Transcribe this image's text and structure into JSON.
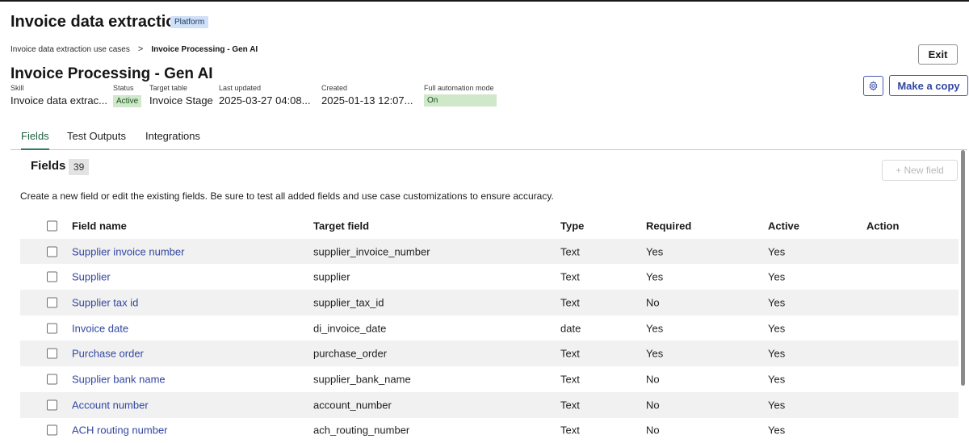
{
  "app": {
    "title": "Invoice data extraction",
    "badge": "Platform"
  },
  "breadcrumb": {
    "parent": "Invoice data extraction use cases",
    "separator": ">",
    "current": "Invoice Processing - Gen AI"
  },
  "page": {
    "title": "Invoice Processing - Gen AI",
    "exit_label": "Exit",
    "copy_label": "Make a copy",
    "settings_icon": "gear-icon"
  },
  "meta": {
    "skill_label": "Skill",
    "skill_value": "Invoice data extrac...",
    "status_label": "Status",
    "status_value": "Active",
    "target_label": "Target table",
    "target_value": "Invoice Stage",
    "updated_label": "Last updated",
    "updated_value": "2025-03-27 04:08...",
    "created_label": "Created",
    "created_value": "2025-01-13 12:07...",
    "automation_label": "Full automation mode",
    "automation_value": "On"
  },
  "tabs": [
    {
      "label": "Fields",
      "active": true
    },
    {
      "label": "Test Outputs",
      "active": false
    },
    {
      "label": "Integrations",
      "active": false
    }
  ],
  "fields": {
    "heading": "Fields",
    "count": "39",
    "new_button": "+ New field",
    "helper": "Create a new field or edit the existing fields. Be sure to test all added fields and use case customizations to ensure accuracy.",
    "columns": [
      "Field name",
      "Target field",
      "Type",
      "Required",
      "Active",
      "Action"
    ],
    "rows": [
      [
        "Supplier invoice number",
        "supplier_invoice_number",
        "Text",
        "Yes",
        "Yes"
      ],
      [
        "Supplier",
        "supplier",
        "Text",
        "Yes",
        "Yes"
      ],
      [
        "Supplier tax id",
        "supplier_tax_id",
        "Text",
        "No",
        "Yes"
      ],
      [
        "Invoice date",
        "di_invoice_date",
        "date",
        "Yes",
        "Yes"
      ],
      [
        "Purchase order",
        "purchase_order",
        "Text",
        "Yes",
        "Yes"
      ],
      [
        "Supplier bank name",
        "supplier_bank_name",
        "Text",
        "No",
        "Yes"
      ],
      [
        "Account number",
        "account_number",
        "Text",
        "No",
        "Yes"
      ],
      [
        "ACH routing number",
        "ach_routing_number",
        "Text",
        "No",
        "Yes"
      ]
    ]
  },
  "colors": {
    "accent": "#3146a0",
    "status_green": "#cfe8c9",
    "tab_active": "#2e7d5b"
  }
}
